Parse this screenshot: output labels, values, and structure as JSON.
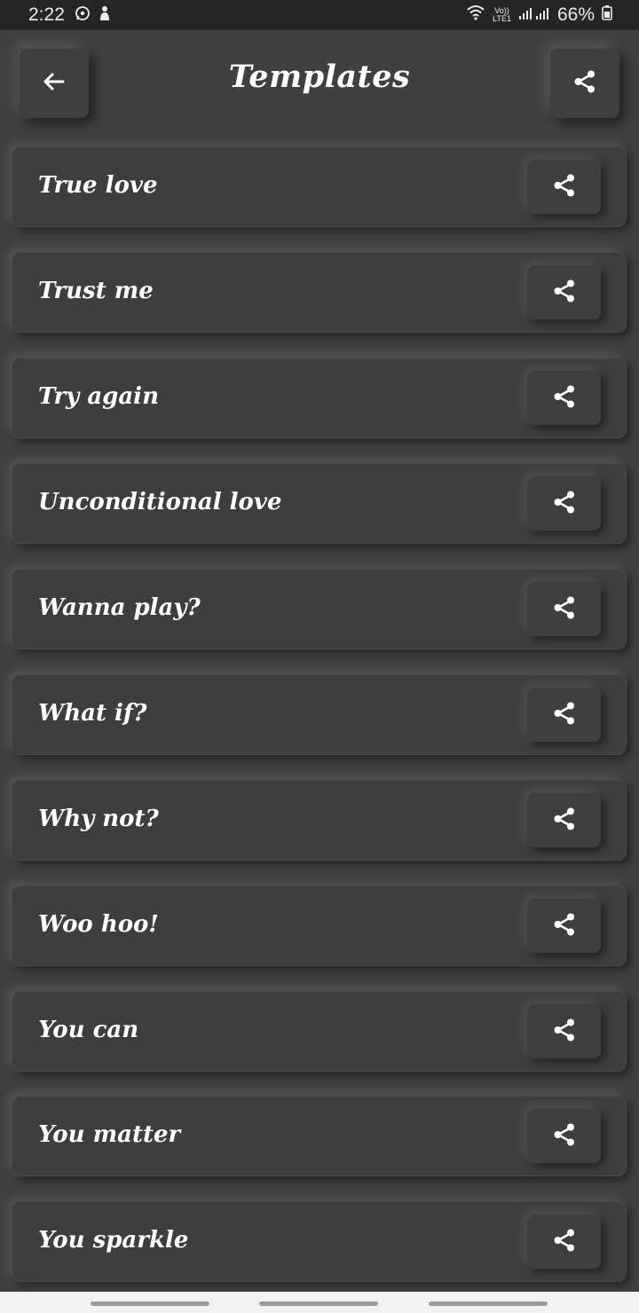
{
  "status_bar": {
    "time": "2:22",
    "network_label_top": "Vo))",
    "network_label_bottom": "LTE1",
    "battery": "66%",
    "icons": [
      "whatsapp-icon",
      "notification-icon",
      "wifi-icon",
      "signal-icon",
      "battery-icon"
    ]
  },
  "header": {
    "title": "Templates",
    "back_icon": "arrow-left-icon",
    "share_icon": "share-icon"
  },
  "templates": [
    {
      "label": "True love"
    },
    {
      "label": "Trust me"
    },
    {
      "label": "Try again"
    },
    {
      "label": "Unconditional love"
    },
    {
      "label": "Wanna play?"
    },
    {
      "label": "What if?"
    },
    {
      "label": "Why not?"
    },
    {
      "label": "Woo hoo!"
    },
    {
      "label": "You can"
    },
    {
      "label": "You matter"
    },
    {
      "label": "You sparkle"
    }
  ],
  "colors": {
    "background": "#404040",
    "statusbar": "#262626",
    "text": "#ffffff",
    "navbar": "#f1f1f1"
  }
}
